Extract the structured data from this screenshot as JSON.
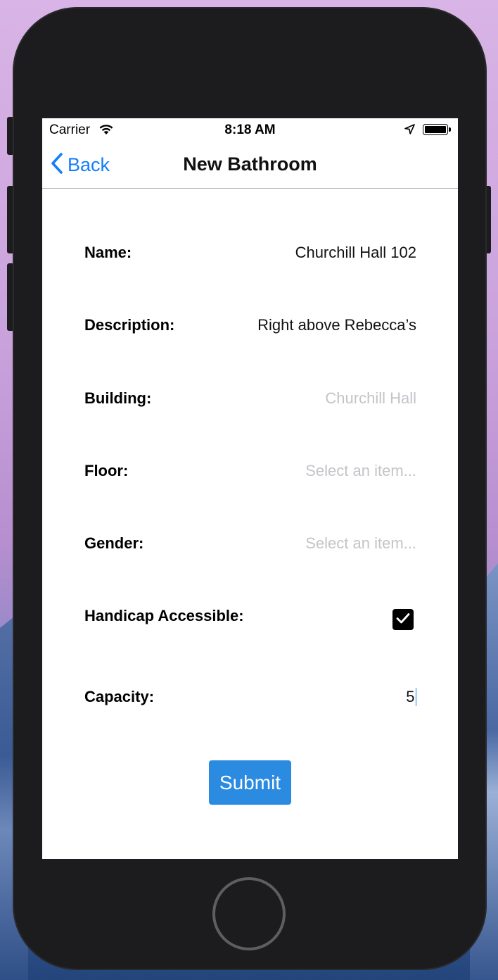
{
  "status_bar": {
    "carrier": "Carrier",
    "time": "8:18 AM",
    "icons": [
      "wifi-icon",
      "location-arrow-icon",
      "battery-icon"
    ]
  },
  "navbar": {
    "back_label": "Back",
    "title": "New Bathroom"
  },
  "form": {
    "name": {
      "label": "Name:",
      "value": "Churchill Hall 102"
    },
    "description": {
      "label": "Description:",
      "value": "Right above Rebecca’s"
    },
    "building": {
      "label": "Building:",
      "placeholder": "Churchill Hall"
    },
    "floor": {
      "label": "Floor:",
      "placeholder": "Select an item..."
    },
    "gender": {
      "label": "Gender:",
      "placeholder": "Select an item..."
    },
    "handicap": {
      "label": "Handicap Accessible:",
      "checked": true
    },
    "capacity": {
      "label": "Capacity:",
      "value": "5"
    }
  },
  "submit_label": "Submit",
  "colors": {
    "accent": "#147efb",
    "button": "#2a8be1",
    "placeholder": "#c4c4c9",
    "device_body": "#1c1c1e"
  }
}
